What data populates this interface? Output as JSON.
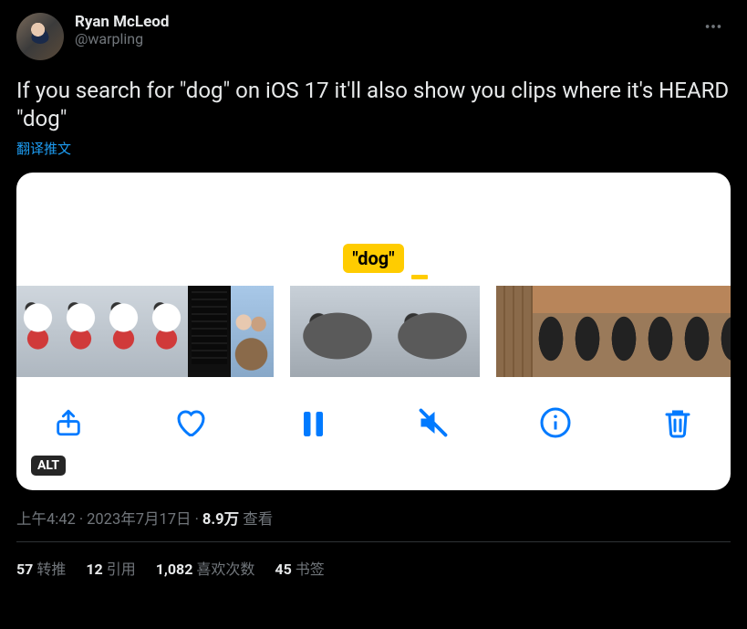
{
  "author": {
    "display_name": "Ryan McLeod",
    "handle": "@warpling"
  },
  "tweet_text": "If you search for \"dog\" on iOS 17 it'll also show you clips where it's HEARD \"dog\"",
  "translate_label": "翻译推文",
  "media": {
    "caption_tag": "\"dog\"",
    "alt_badge": "ALT"
  },
  "timestamp": {
    "time": "上午4:42",
    "date": "2023年7月17日",
    "views_count": "8.9万",
    "views_label": "查看"
  },
  "stats": {
    "retweets": {
      "count": "57",
      "label": "转推"
    },
    "quotes": {
      "count": "12",
      "label": "引用"
    },
    "likes": {
      "count": "1,082",
      "label": "喜欢次数"
    },
    "bookmarks": {
      "count": "45",
      "label": "书签"
    }
  }
}
